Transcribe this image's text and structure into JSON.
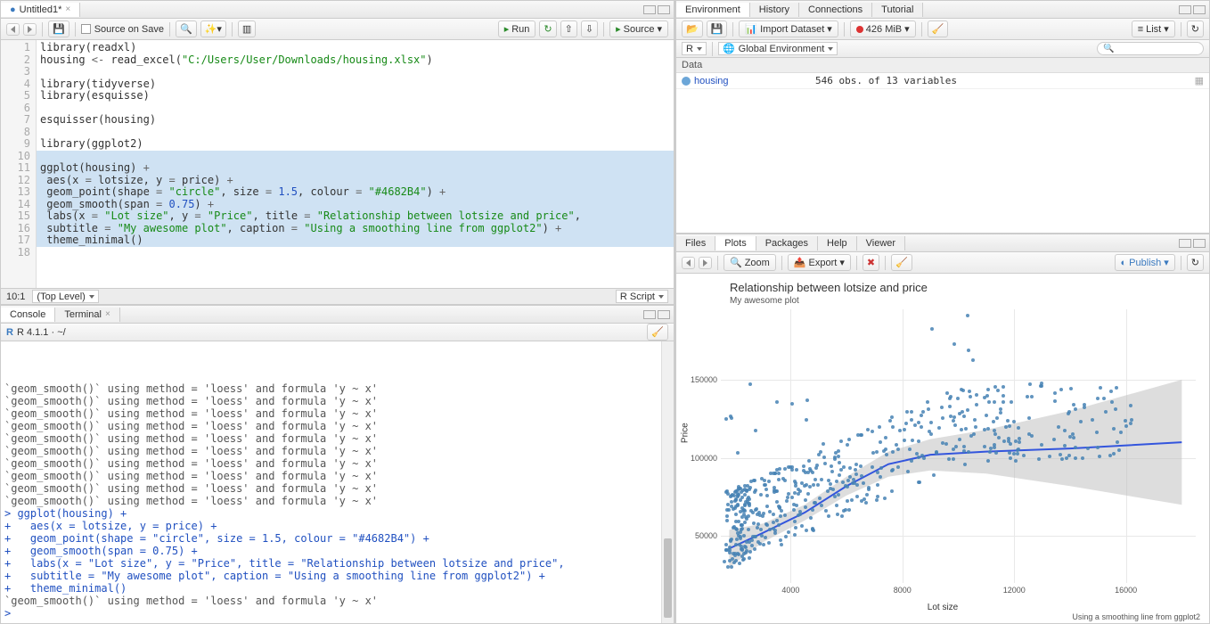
{
  "source": {
    "tab_title": "Untitled1*",
    "source_on_save": "Source on Save",
    "run": "Run",
    "source_btn": "Source",
    "cursor_pos": "10:1",
    "scope": "(Top Level)",
    "file_type": "R Script",
    "code_lines": [
      {
        "n": 1,
        "tokens": [
          {
            "t": "library",
            "c": "fn"
          },
          {
            "t": "(readxl)",
            "c": ""
          }
        ]
      },
      {
        "n": 2,
        "tokens": [
          {
            "t": "housing ",
            "c": ""
          },
          {
            "t": "<-",
            "c": "op"
          },
          {
            "t": " read_excel(",
            "c": ""
          },
          {
            "t": "\"C:/Users/User/Downloads/housing.xlsx\"",
            "c": "str"
          },
          {
            "t": ")",
            "c": ""
          }
        ]
      },
      {
        "n": 3,
        "tokens": []
      },
      {
        "n": 4,
        "tokens": [
          {
            "t": "library",
            "c": "fn"
          },
          {
            "t": "(tidyverse)",
            "c": ""
          }
        ]
      },
      {
        "n": 5,
        "tokens": [
          {
            "t": "library",
            "c": "fn"
          },
          {
            "t": "(esquisse)",
            "c": ""
          }
        ]
      },
      {
        "n": 6,
        "tokens": []
      },
      {
        "n": 7,
        "tokens": [
          {
            "t": "esquisser(housing)",
            "c": ""
          }
        ]
      },
      {
        "n": 8,
        "tokens": []
      },
      {
        "n": 9,
        "tokens": [
          {
            "t": "library",
            "c": "fn"
          },
          {
            "t": "(ggplot2)",
            "c": ""
          }
        ]
      },
      {
        "n": 10,
        "tokens": [],
        "hl": true
      },
      {
        "n": 11,
        "tokens": [
          {
            "t": "ggplot(housing) ",
            "c": ""
          },
          {
            "t": "+",
            "c": "op"
          }
        ],
        "hl": true
      },
      {
        "n": 12,
        "tokens": [
          {
            "t": " aes(x ",
            "c": ""
          },
          {
            "t": "=",
            "c": "op"
          },
          {
            "t": " lotsize, y ",
            "c": ""
          },
          {
            "t": "=",
            "c": "op"
          },
          {
            "t": " price) ",
            "c": ""
          },
          {
            "t": "+",
            "c": "op"
          }
        ],
        "hl": true
      },
      {
        "n": 13,
        "tokens": [
          {
            "t": " geom_point(shape ",
            "c": ""
          },
          {
            "t": "=",
            "c": "op"
          },
          {
            "t": " ",
            "c": ""
          },
          {
            "t": "\"circle\"",
            "c": "str"
          },
          {
            "t": ", size ",
            "c": ""
          },
          {
            "t": "=",
            "c": "op"
          },
          {
            "t": " ",
            "c": ""
          },
          {
            "t": "1.5",
            "c": "num"
          },
          {
            "t": ", colour ",
            "c": ""
          },
          {
            "t": "=",
            "c": "op"
          },
          {
            "t": " ",
            "c": ""
          },
          {
            "t": "\"#4682B4\"",
            "c": "str"
          },
          {
            "t": ") ",
            "c": ""
          },
          {
            "t": "+",
            "c": "op"
          }
        ],
        "hl": true
      },
      {
        "n": 14,
        "tokens": [
          {
            "t": " geom_smooth(span ",
            "c": ""
          },
          {
            "t": "=",
            "c": "op"
          },
          {
            "t": " ",
            "c": ""
          },
          {
            "t": "0.75",
            "c": "num"
          },
          {
            "t": ") ",
            "c": ""
          },
          {
            "t": "+",
            "c": "op"
          }
        ],
        "hl": true
      },
      {
        "n": 15,
        "tokens": [
          {
            "t": " labs(x ",
            "c": ""
          },
          {
            "t": "=",
            "c": "op"
          },
          {
            "t": " ",
            "c": ""
          },
          {
            "t": "\"Lot size\"",
            "c": "str"
          },
          {
            "t": ", y ",
            "c": ""
          },
          {
            "t": "=",
            "c": "op"
          },
          {
            "t": " ",
            "c": ""
          },
          {
            "t": "\"Price\"",
            "c": "str"
          },
          {
            "t": ", title ",
            "c": ""
          },
          {
            "t": "=",
            "c": "op"
          },
          {
            "t": " ",
            "c": ""
          },
          {
            "t": "\"Relationship between lotsize and price\"",
            "c": "str"
          },
          {
            "t": ",",
            "c": ""
          }
        ],
        "hl": true
      },
      {
        "n": 16,
        "tokens": [
          {
            "t": " subtitle ",
            "c": ""
          },
          {
            "t": "=",
            "c": "op"
          },
          {
            "t": " ",
            "c": ""
          },
          {
            "t": "\"My awesome plot\"",
            "c": "str"
          },
          {
            "t": ", caption ",
            "c": ""
          },
          {
            "t": "=",
            "c": "op"
          },
          {
            "t": " ",
            "c": ""
          },
          {
            "t": "\"Using a smoothing line from ggplot2\"",
            "c": "str"
          },
          {
            "t": ") ",
            "c": ""
          },
          {
            "t": "+",
            "c": "op"
          }
        ],
        "hl": true
      },
      {
        "n": 17,
        "tokens": [
          {
            "t": " theme_minimal()",
            "c": ""
          }
        ],
        "hl": true
      },
      {
        "n": 18,
        "tokens": []
      }
    ]
  },
  "console": {
    "tab_console": "Console",
    "tab_terminal": "Terminal",
    "prompt_label": "R 4.1.1 · ~/",
    "lines": [
      {
        "t": "`geom_smooth()` using method = 'loess' and formula 'y ~ x'",
        "c": "msg"
      },
      {
        "t": "`geom_smooth()` using method = 'loess' and formula 'y ~ x'",
        "c": "msg"
      },
      {
        "t": "`geom_smooth()` using method = 'loess' and formula 'y ~ x'",
        "c": "msg"
      },
      {
        "t": "`geom_smooth()` using method = 'loess' and formula 'y ~ x'",
        "c": "msg"
      },
      {
        "t": "`geom_smooth()` using method = 'loess' and formula 'y ~ x'",
        "c": "msg"
      },
      {
        "t": "`geom_smooth()` using method = 'loess' and formula 'y ~ x'",
        "c": "msg"
      },
      {
        "t": "`geom_smooth()` using method = 'loess' and formula 'y ~ x'",
        "c": "msg"
      },
      {
        "t": "`geom_smooth()` using method = 'loess' and formula 'y ~ x'",
        "c": "msg"
      },
      {
        "t": "`geom_smooth()` using method = 'loess' and formula 'y ~ x'",
        "c": "msg"
      },
      {
        "t": "`geom_smooth()` using method = 'loess' and formula 'y ~ x'",
        "c": "msg"
      },
      {
        "t": "> ggplot(housing) +",
        "c": "cmd"
      },
      {
        "t": "+   aes(x = lotsize, y = price) +",
        "c": "cmd"
      },
      {
        "t": "+   geom_point(shape = \"circle\", size = 1.5, colour = \"#4682B4\") +",
        "c": "cmd"
      },
      {
        "t": "+   geom_smooth(span = 0.75) +",
        "c": "cmd"
      },
      {
        "t": "+   labs(x = \"Lot size\", y = \"Price\", title = \"Relationship between lotsize and price\",",
        "c": "cmd"
      },
      {
        "t": "+   subtitle = \"My awesome plot\", caption = \"Using a smoothing line from ggplot2\") +",
        "c": "cmd"
      },
      {
        "t": "+   theme_minimal()",
        "c": "cmd"
      },
      {
        "t": "`geom_smooth()` using method = 'loess' and formula 'y ~ x'",
        "c": "msg"
      },
      {
        "t": "> ",
        "c": "cmd"
      }
    ]
  },
  "env": {
    "tabs": {
      "environment": "Environment",
      "history": "History",
      "connections": "Connections",
      "tutorial": "Tutorial"
    },
    "import": "Import Dataset",
    "mem": "426 MiB",
    "list": "List",
    "scope_r": "R",
    "scope_env": "Global Environment",
    "data_header": "Data",
    "rows": [
      {
        "name": "housing",
        "val": "546 obs. of 13 variables"
      }
    ]
  },
  "plots": {
    "tabs": {
      "files": "Files",
      "plots": "Plots",
      "packages": "Packages",
      "help": "Help",
      "viewer": "Viewer"
    },
    "zoom": "Zoom",
    "export": "Export",
    "publish": "Publish",
    "title": "Relationship between lotsize and price",
    "subtitle": "My awesome plot",
    "xlabel": "Lot size",
    "ylabel": "Price",
    "caption": "Using a smoothing line from ggplot2"
  },
  "chart_data": {
    "type": "scatter",
    "title": "Relationship between lotsize and price",
    "subtitle": "My awesome plot",
    "xlabel": "Lot size",
    "ylabel": "Price",
    "xlim": [
      1500,
      18500
    ],
    "ylim": [
      20000,
      195000
    ],
    "x_ticks": [
      4000,
      8000,
      12000,
      16000
    ],
    "y_ticks": [
      50000,
      100000,
      150000
    ],
    "n_points": 546,
    "smooth": [
      {
        "x": 1800,
        "y": 42000,
        "lo": 30000,
        "hi": 54000
      },
      {
        "x": 3000,
        "y": 52000,
        "lo": 46000,
        "hi": 58000
      },
      {
        "x": 4500,
        "y": 65000,
        "lo": 60000,
        "hi": 70000
      },
      {
        "x": 6000,
        "y": 82000,
        "lo": 76000,
        "hi": 88000
      },
      {
        "x": 7500,
        "y": 96000,
        "lo": 88000,
        "hi": 104000
      },
      {
        "x": 9000,
        "y": 102000,
        "lo": 92000,
        "hi": 112000
      },
      {
        "x": 11000,
        "y": 104000,
        "lo": 90000,
        "hi": 118000
      },
      {
        "x": 14000,
        "y": 106000,
        "lo": 82000,
        "hi": 130000
      },
      {
        "x": 18000,
        "y": 110000,
        "lo": 70000,
        "hi": 150000
      }
    ]
  }
}
